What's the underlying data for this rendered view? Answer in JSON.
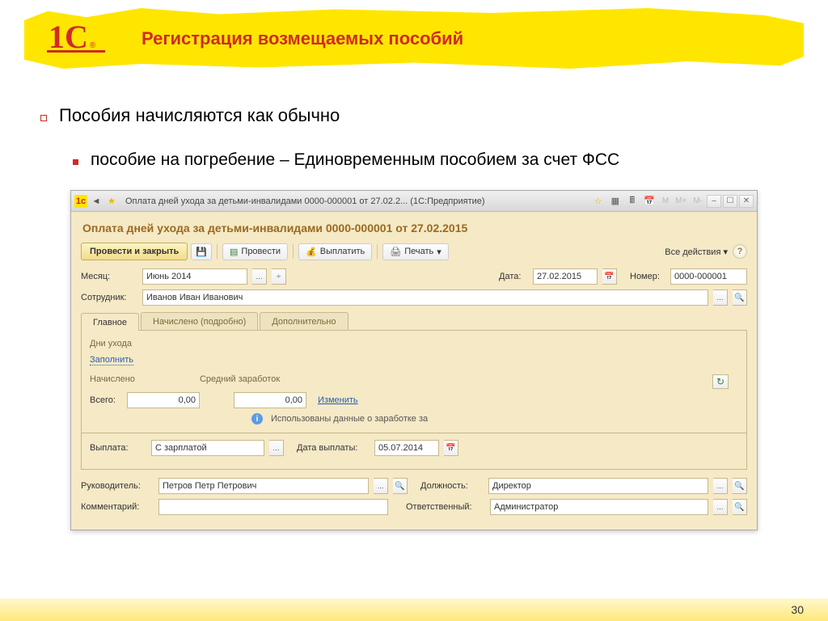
{
  "slide": {
    "title": "Регистрация возмещаемых пособий",
    "bullet1": "Пособия начисляются как обычно",
    "bullet2": "пособие на погребение – Единовременным пособием за счет ФСС",
    "page_number": "30"
  },
  "titlebar": {
    "text": "Оплата дней ухода за детьми-инвалидами 0000-000001 от 27.02.2...   (1С:Предприятие)",
    "m1": "M",
    "m2": "M+",
    "m3": "M-"
  },
  "doc": {
    "title": "Оплата дней ухода за детьми-инвалидами 0000-000001 от 27.02.2015"
  },
  "toolbar": {
    "btn_primary": "Провести и закрыть",
    "btn_post": "Провести",
    "btn_pay": "Выплатить",
    "btn_print": "Печать",
    "all_actions": "Все действия"
  },
  "form": {
    "month_label": "Месяц:",
    "month_value": "Июнь 2014",
    "date_label": "Дата:",
    "date_value": "27.02.2015",
    "number_label": "Номер:",
    "number_value": "0000-000001",
    "employee_label": "Сотрудник:",
    "employee_value": "Иванов Иван Иванович"
  },
  "tabs": {
    "t1": "Главное",
    "t2": "Начислено (подробно)",
    "t3": "Дополнительно"
  },
  "panel": {
    "days_label": "Дни ухода",
    "fill_link": "Заполнить",
    "accrued_label": "Начислено",
    "avg_label": "Средний заработок",
    "total_label": "Всего:",
    "total_value": "0,00",
    "avg_value": "0,00",
    "change_link": "Изменить",
    "info_text": "Использованы данные о заработке за",
    "payout_label": "Выплата:",
    "payout_value": "С зарплатой",
    "payout_date_label": "Дата выплаты:",
    "payout_date_value": "05.07.2014"
  },
  "footer": {
    "manager_label": "Руководитель:",
    "manager_value": "Петров Петр Петрович",
    "position_label": "Должность:",
    "position_value": "Директор",
    "comment_label": "Комментарий:",
    "comment_value": "",
    "responsible_label": "Ответственный:",
    "responsible_value": "Администратор"
  }
}
